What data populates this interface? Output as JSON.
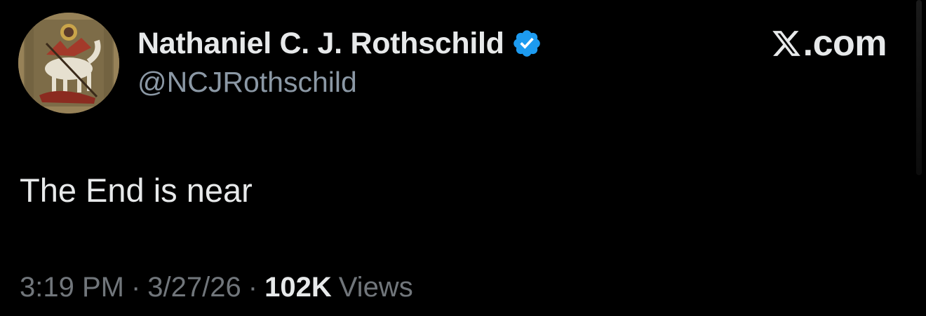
{
  "tweet": {
    "display_name": "Nathaniel C. J. Rothschild",
    "handle": "@NCJRothschild",
    "verified": true,
    "verified_icon": "verified-badge-icon",
    "text": "The End is near",
    "time": "3:19 PM",
    "date": "3/27/26",
    "separator": "·",
    "views_count": "102K",
    "views_label": "Views"
  },
  "brand": {
    "label": ".com",
    "logo_icon": "x-logo-icon"
  },
  "colors": {
    "background": "#000000",
    "primary_text": "#e7e9ea",
    "secondary_text": "#71767b",
    "handle_text": "#8b98a5",
    "verified_blue": "#1d9bf0"
  }
}
